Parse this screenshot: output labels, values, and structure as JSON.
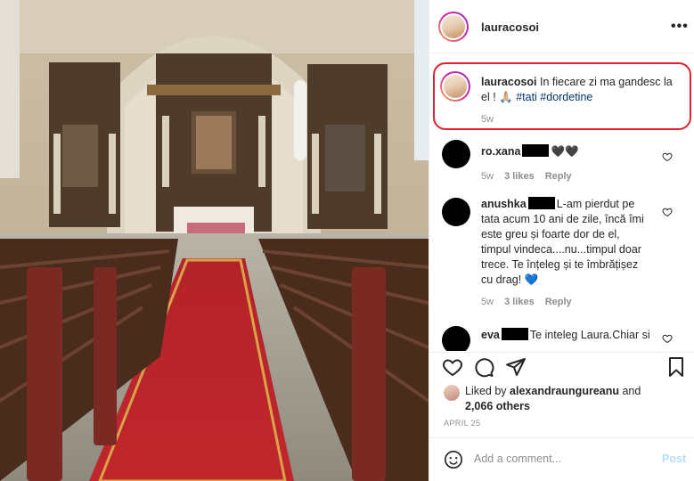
{
  "post": {
    "username": "lauracosoi",
    "more_label": "•••"
  },
  "caption": {
    "username": "lauracosoi",
    "line1": "In fiecare zi ma gandesc la",
    "line2_text": "el ! 🙏🏼 ",
    "hashtags": "#tati #dordetine",
    "time": "5w"
  },
  "comments": [
    {
      "username": "ro.xana",
      "text": "🖤🖤",
      "time": "5w",
      "likes": "3 likes",
      "reply": "Reply"
    },
    {
      "username": "anushka",
      "lines": [
        "L-am pierdut pe",
        "tata acum 10 ani de zile, încă îmi",
        "este greu și foarte dor de el,",
        "timpul vindeca....nu...timpul doar",
        "trece. Te înțeleg și te îmbrățișez",
        "cu drag! 💙"
      ],
      "time": "5w",
      "likes": "3 likes",
      "reply": "Reply"
    },
    {
      "username": "eva",
      "text": "Te inteleg Laura.Chiar si"
    }
  ],
  "likes": {
    "prefix": "Liked by",
    "user": "alexandraungureanu",
    "and": "and",
    "others": "2,066 others"
  },
  "date": "APRIL 25",
  "add_comment": {
    "placeholder": "Add a comment...",
    "post_label": "Post"
  },
  "icons": [
    "heart-icon",
    "comment-icon",
    "share-icon",
    "bookmark-icon",
    "emoji-icon",
    "more-icon"
  ],
  "colors": {
    "accent": "#0095f6",
    "highlight_box": "#e0202b",
    "hashtag": "#00376b",
    "muted": "#8e8e8e"
  }
}
